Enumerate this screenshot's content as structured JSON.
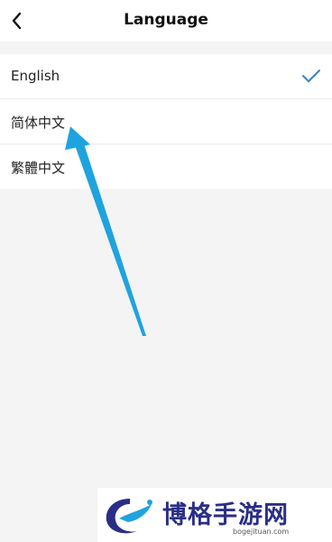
{
  "header": {
    "title": "Language",
    "back_icon": "chevron-left-icon"
  },
  "languages": [
    {
      "label": "English",
      "selected": true
    },
    {
      "label": "简体中文",
      "selected": false
    },
    {
      "label": "繁體中文",
      "selected": false
    }
  ],
  "annotation": {
    "arrow_color": "#1fa3df",
    "points_to": "简体中文"
  },
  "watermark": {
    "brand": "博格手游网",
    "url": "bogejituan.com",
    "brand_color": "#2a2f86"
  },
  "colors": {
    "check": "#3a82c4",
    "background": "#f4f4f4"
  }
}
